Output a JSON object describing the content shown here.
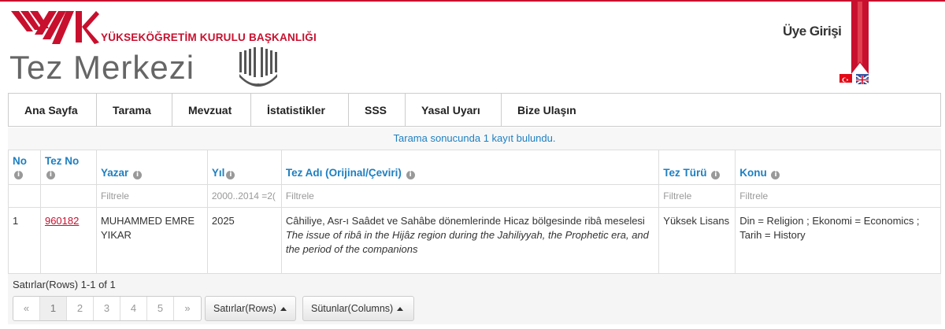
{
  "header": {
    "org_name": "YÜKSEKÖĞRETİM KURULU BAŞKANLIĞI",
    "site_title": "Tez Merkezi",
    "member_login": "Üye Girişi",
    "brand_color": "#c8102e"
  },
  "nav": {
    "items": [
      {
        "label": "Ana Sayfa"
      },
      {
        "label": "Tarama"
      },
      {
        "label": "Mevzuat"
      },
      {
        "label": "İstatistikler"
      },
      {
        "label": "SSS"
      },
      {
        "label": "Yasal Uyarı"
      },
      {
        "label": "Bize Ulaşın"
      }
    ]
  },
  "result_text": "Tarama sonucunda 1 kayıt bulundu.",
  "table": {
    "headers": {
      "no": "No",
      "tez_no": "Tez No",
      "yazar": "Yazar",
      "yil": "Yıl",
      "tez_adi": "Tez Adı (Orijinal/Çeviri)",
      "tez_turu": "Tez Türü",
      "konu": "Konu"
    },
    "filters": {
      "yazar": "Filtrele",
      "yil": "2000..2014 =2(",
      "tez_adi": "Filtrele",
      "tez_turu": "Filtrele",
      "konu": "Filtrele"
    },
    "rows": [
      {
        "no": "1",
        "tez_no": "960182",
        "yazar": "MUHAMMED EMRE YIKAR",
        "yil": "2025",
        "title_original": "Câhiliye, Asr-ı Saâdet ve Sahâbe dönemlerinde Hicaz bölgesinde ribâ meselesi",
        "title_translation": "The issue of ribâ in the Hijâz region during the Jahiliyyah, the Prophetic era, and the period of the companions",
        "tez_turu": "Yüksek Lisans",
        "konu": "Din = Religion ; Ekonomi = Economics ; Tarih = History"
      }
    ]
  },
  "footer": {
    "rows_info": "Satırlar(Rows) 1-1 of 1",
    "pager": [
      "«",
      "1",
      "2",
      "3",
      "4",
      "5",
      "»"
    ],
    "rows_button": "Satırlar(Rows)",
    "columns_button": "Sütunlar(Columns)"
  }
}
